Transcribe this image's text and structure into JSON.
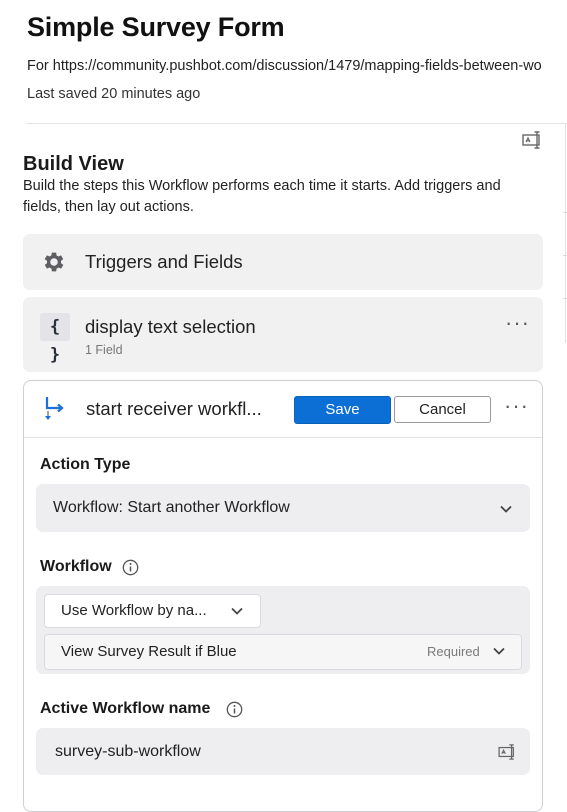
{
  "header": {
    "title": "Simple Survey Form",
    "for_text": "For https://community.pushbot.com/discussion/1479/mapping-fields-between-wo",
    "last_saved": "Last saved 20 minutes ago"
  },
  "build_view": {
    "title": "Build View",
    "description": "Build the steps this Workflow performs each time it starts. Add triggers and fields, then lay out actions."
  },
  "steps": {
    "triggers": {
      "label": "Triggers and Fields",
      "icon": "gear-icon"
    },
    "display": {
      "label": "display text selection",
      "sub": "1 Field",
      "icon": "braces-icon",
      "menu": "···"
    }
  },
  "action": {
    "name": "start receiver workfl...",
    "icon": "workflow-branch-icon",
    "save_label": "Save",
    "cancel_label": "Cancel",
    "menu": "···",
    "action_type_label": "Action Type",
    "action_type_value": "Workflow: Start another Workflow",
    "workflow_label": "Workflow",
    "workflow_mode_value": "Use Workflow by na...",
    "workflow_value": "View Survey Result if Blue",
    "required_text": "Required",
    "active_name_label": "Active Workflow name",
    "active_name_value": "survey-sub-workflow"
  },
  "colors": {
    "accent": "#0b6fd6",
    "card_bg": "#f1f1f2",
    "field_bg": "#eeeef1"
  }
}
